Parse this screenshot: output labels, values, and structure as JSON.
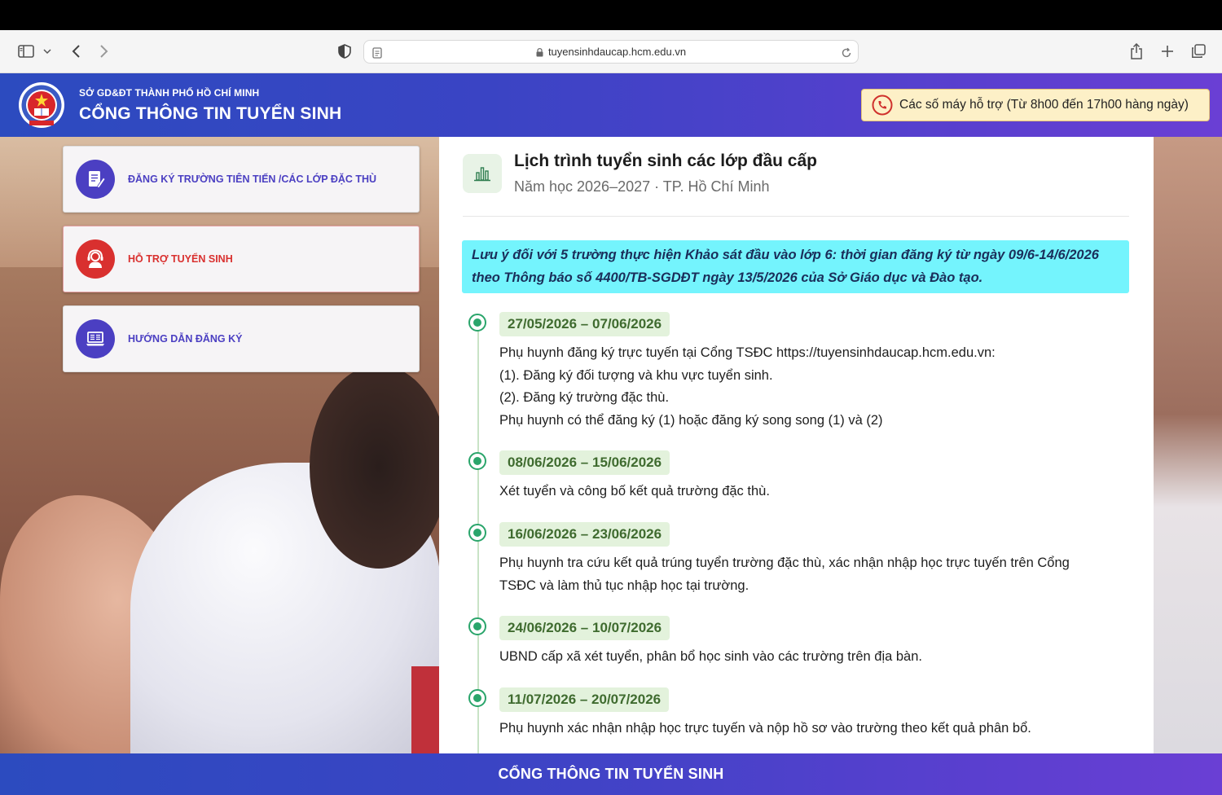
{
  "browser": {
    "url": "tuyensinhdaucap.hcm.edu.vn"
  },
  "header": {
    "sub_title": "SỞ GD&ĐT THÀNH PHỐ HỒ CHÍ MINH",
    "title": "CỔNG THÔNG TIN TUYỂN SINH",
    "support": "Các số máy hỗ trợ (Từ 8h00 đến 17h00 hàng ngày)"
  },
  "menu": [
    {
      "label": "ĐĂNG KÝ TRƯỜNG TIÊN TIẾN /CÁC LỚP ĐẶC THÙ",
      "color": "#4b3fc2"
    },
    {
      "label": "HỖ TRỢ TUYỂN SINH",
      "color": "#d9302f"
    },
    {
      "label": "HƯỚNG DẪN ĐĂNG KÝ",
      "color": "#4b3fc2"
    }
  ],
  "panel": {
    "title": "Lịch trình tuyển sinh các lớp đầu cấp",
    "subtitle": "Năm học 2026–2027 · TP. Hồ Chí Minh",
    "notice_line1": "Lưu ý đối với 5 trường thực hiện Khảo sát đầu vào lớp 6: thời gian đăng ký từ ngày 09/6-14/6/2026",
    "notice_line2": "theo Thông báo số 4400/TB-SGDĐT ngày 13/5/2026 của Sở Giáo dục và Đào tạo.",
    "timeline": [
      {
        "date": "27/05/2026 – 07/06/2026",
        "lines": [
          "Phụ huynh đăng ký trực tuyến tại Cổng TSĐC https://tuyensinhdaucap.hcm.edu.vn:",
          "(1). Đăng ký đối tượng và khu vực tuyển sinh.",
          "(2). Đăng ký trường đặc thù.",
          "Phụ huynh có thể đăng ký (1) hoặc đăng ký song song (1) và (2)"
        ]
      },
      {
        "date": "08/06/2026 – 15/06/2026",
        "lines": [
          "Xét tuyển và công bố kết quả trường đặc thù."
        ]
      },
      {
        "date": "16/06/2026 – 23/06/2026",
        "lines": [
          "Phụ huynh tra cứu kết quả trúng tuyển trường đặc thù, xác nhận nhập học trực tuyến trên Cổng",
          "TSĐC và làm thủ tục nhập học tại trường."
        ]
      },
      {
        "date": "24/06/2026 – 10/07/2026",
        "lines": [
          "UBND cấp xã xét tuyển, phân bổ học sinh vào các trường trên địa bàn."
        ]
      },
      {
        "date": "11/07/2026 – 20/07/2026",
        "lines": [
          "Phụ huynh xác nhận nhập học trực tuyến và nộp hồ sơ vào trường theo kết quả phân bổ."
        ]
      }
    ]
  },
  "footer": {
    "title": "CỔNG THÔNG TIN TUYỂN SINH"
  },
  "colors": {
    "header_start": "#2c4bbf",
    "header_end": "#6a3fd4",
    "notice_bg": "#74f4fd",
    "timeline_green": "#2aa56b",
    "date_bg": "#e3f2dc"
  }
}
